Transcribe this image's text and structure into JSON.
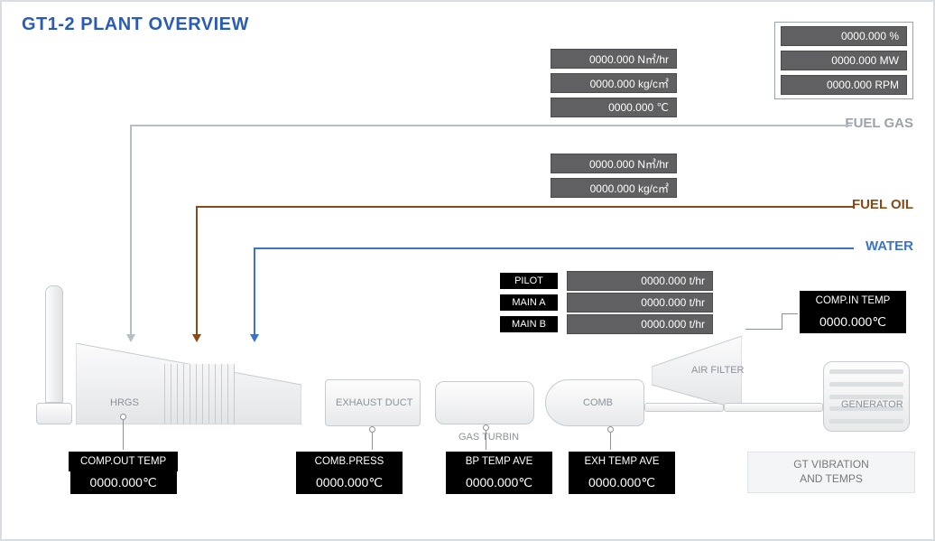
{
  "title": "GT1-2 PLANT OVERVIEW",
  "flows": {
    "fuel_gas": "FUEL GAS",
    "fuel_oil": "FUEL OIL",
    "water": "WATER"
  },
  "colors": {
    "fuel_gas": "#b8bfc4",
    "fuel_oil": "#8a4a17",
    "water": "#3b74c6"
  },
  "top_right_box": {
    "val1": "0000.000 %",
    "val2": "0000.000 MW",
    "val3": "0000.000 RPM"
  },
  "fuel_gas_box": {
    "v1": "0000.000 N㎥/hr",
    "v2": "0000.000 kg/c㎡",
    "v3": "0000.000 ℃"
  },
  "fuel_oil_box": {
    "v1": "0000.000 N㎥/hr",
    "v2": "0000.000 kg/c㎡"
  },
  "burner_rows": {
    "pilot": {
      "label": "PILOT",
      "value": "0000.000 t/hr"
    },
    "main_a": {
      "label": "MAIN A",
      "value": "0000.000 t/hr"
    },
    "main_b": {
      "label": "MAIN B",
      "value": "0000.000 t/hr"
    }
  },
  "comp_in_temp": {
    "label": "COMP.IN TEMP",
    "value": "0000.000℃"
  },
  "equipment_labels": {
    "hrgs": "HRGS",
    "exhaust_duct": "EXHAUST DUCT",
    "gas_turbine": "GAS TURBIN",
    "comb": "COMB",
    "air_filter": "AIR FILTER",
    "generator": "GENERATOR"
  },
  "bottom_blocks": {
    "comp_out_temp": {
      "label": "COMP.OUT TEMP",
      "value": "0000.000℃"
    },
    "comb_press": {
      "label": "COMB.PRESS",
      "value": "0000.000℃"
    },
    "bp_temp_ave": {
      "label": "BP TEMP AVE",
      "value": "0000.000℃"
    },
    "exh_temp_ave": {
      "label": "EXH TEMP AVE",
      "value": "0000.000℃"
    }
  },
  "vibration_panel": "GT VIBRATION\nAND TEMPS"
}
